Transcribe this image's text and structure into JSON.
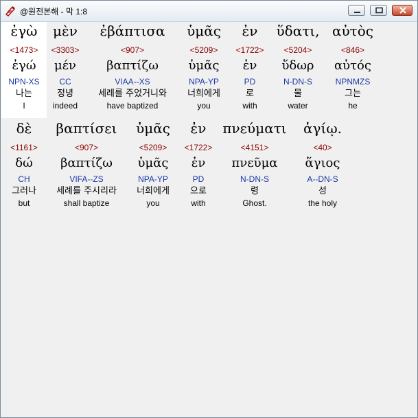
{
  "window": {
    "title": "@원전본해 - 막 1:8",
    "app_icon": "bible-icon",
    "buttons": [
      "minimize-icon",
      "maximize-icon",
      "close-icon"
    ]
  },
  "colors": {
    "strong": "#8b0000",
    "morph": "#1a3aa8",
    "text": "#000000",
    "background": "#f0f0f0"
  },
  "rows": [
    {
      "words": [
        {
          "greek": "ἐγὼ",
          "strong": "<1473>",
          "lemma": "ἐγώ",
          "morph": "NPN-XS",
          "korean": "나는",
          "english": "I"
        },
        {
          "greek": "μὲν",
          "strong": "<3303>",
          "lemma": "μέν",
          "morph": "CC",
          "korean": "정녕",
          "english": "indeed"
        },
        {
          "greek": "ἐβάπτισα",
          "strong": "<907>",
          "lemma": "βαπτίζω",
          "morph": "VIAA--XS",
          "korean": "세례를 주었거니와",
          "english": "have baptized"
        },
        {
          "greek": "ὑμᾶς",
          "strong": "<5209>",
          "lemma": "ὑμᾶς",
          "morph": "NPA-YP",
          "korean": "너희에게",
          "english": "you"
        },
        {
          "greek": "ἐν",
          "strong": "<1722>",
          "lemma": "ἐν",
          "morph": "PD",
          "korean": "로",
          "english": "with"
        },
        {
          "greek": "ὕδατι,",
          "strong": "<5204>",
          "lemma": "ὕδωρ",
          "morph": "N-DN-S",
          "korean": "물",
          "english": "water"
        },
        {
          "greek": "αὐτὸς",
          "strong": "<846>",
          "lemma": "αὐτός",
          "morph": "NPNMZS",
          "korean": "그는",
          "english": "he"
        }
      ]
    },
    {
      "words": [
        {
          "greek": "δὲ",
          "strong": "<1161>",
          "lemma": "δώ",
          "morph": "CH",
          "korean": "그러나",
          "english": "but"
        },
        {
          "greek": "βαπτίσει",
          "strong": "<907>",
          "lemma": "βαπτίζω",
          "morph": "VIFA--ZS",
          "korean": "세례를 주시리라",
          "english": "shall baptize"
        },
        {
          "greek": "ὑμᾶς",
          "strong": "<5209>",
          "lemma": "ὑμᾶς",
          "morph": "NPA-YP",
          "korean": "너희에게",
          "english": "you"
        },
        {
          "greek": "ἐν",
          "strong": "<1722>",
          "lemma": "ἐν",
          "morph": "PD",
          "korean": "으로",
          "english": "with"
        },
        {
          "greek": "πνεύματι",
          "strong": "<4151>",
          "lemma": "πνεῦμα",
          "morph": "N-DN-S",
          "korean": "령",
          "english": "Ghost."
        },
        {
          "greek": "ἁγίῳ.",
          "strong": "<40>",
          "lemma": "ἅγιος",
          "morph": "A--DN-S",
          "korean": "성",
          "english": "the holy"
        }
      ]
    }
  ]
}
